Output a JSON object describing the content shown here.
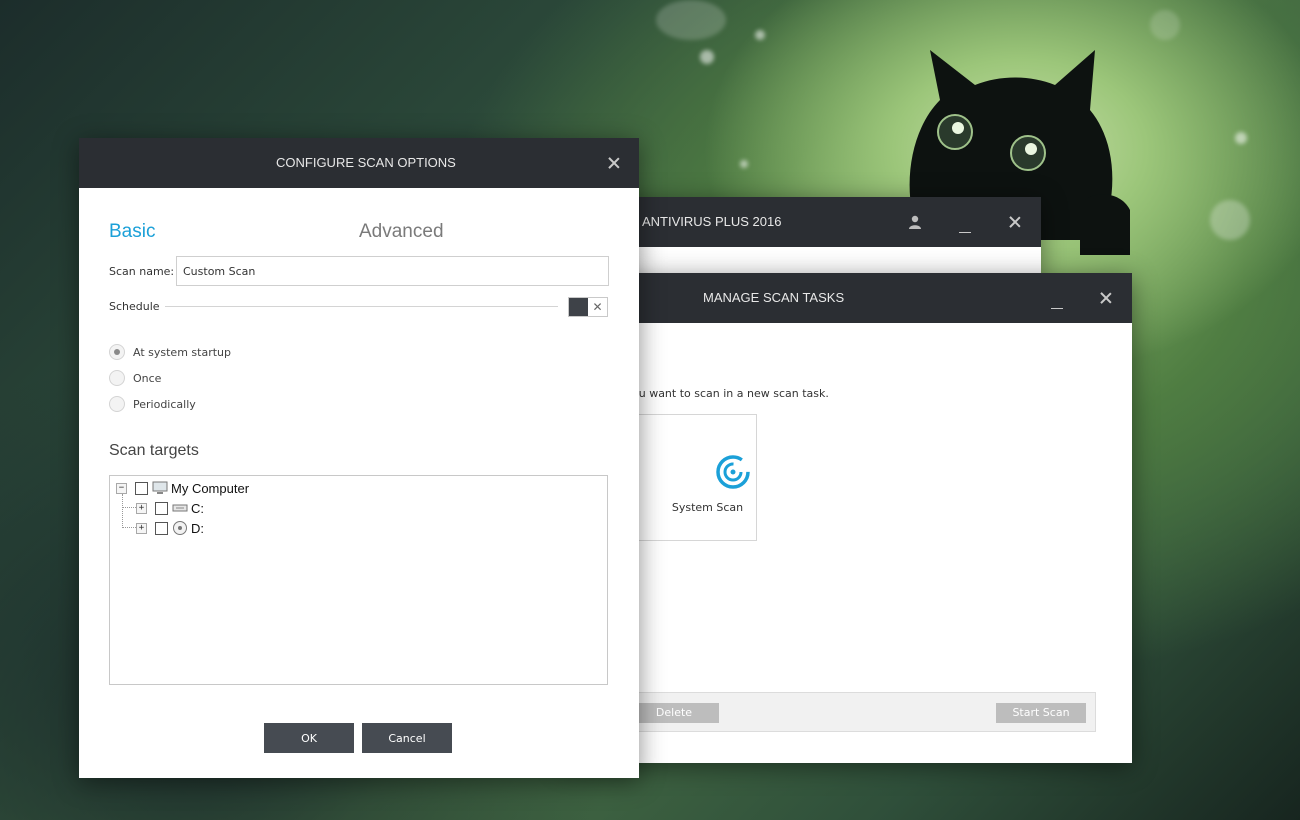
{
  "main_window": {
    "title": "ANTIVIRUS PLUS 2016"
  },
  "manage_window": {
    "title": "MANAGE SCAN TASKS",
    "instruction": "ou want to scan in a new scan task.",
    "tile_label": "System Scan",
    "delete_label": "Delete",
    "start_label": "Start Scan"
  },
  "config_dialog": {
    "title": "CONFIGURE SCAN OPTIONS",
    "tabs": {
      "basic": "Basic",
      "advanced": "Advanced"
    },
    "scan_name_label": "Scan name:",
    "scan_name_value": "Custom Scan",
    "schedule_label": "Schedule",
    "schedule_options": [
      "At system startup",
      "Once",
      "Periodically"
    ],
    "selected_option": "At system startup",
    "scan_targets_heading": "Scan targets",
    "tree": {
      "root": "My Computer",
      "drives": [
        "C:",
        "D:"
      ]
    },
    "ok_label": "OK",
    "cancel_label": "Cancel"
  },
  "colors": {
    "accent": "#1ba0d8",
    "titlebar": "#2b2e33",
    "button": "#464b52"
  }
}
